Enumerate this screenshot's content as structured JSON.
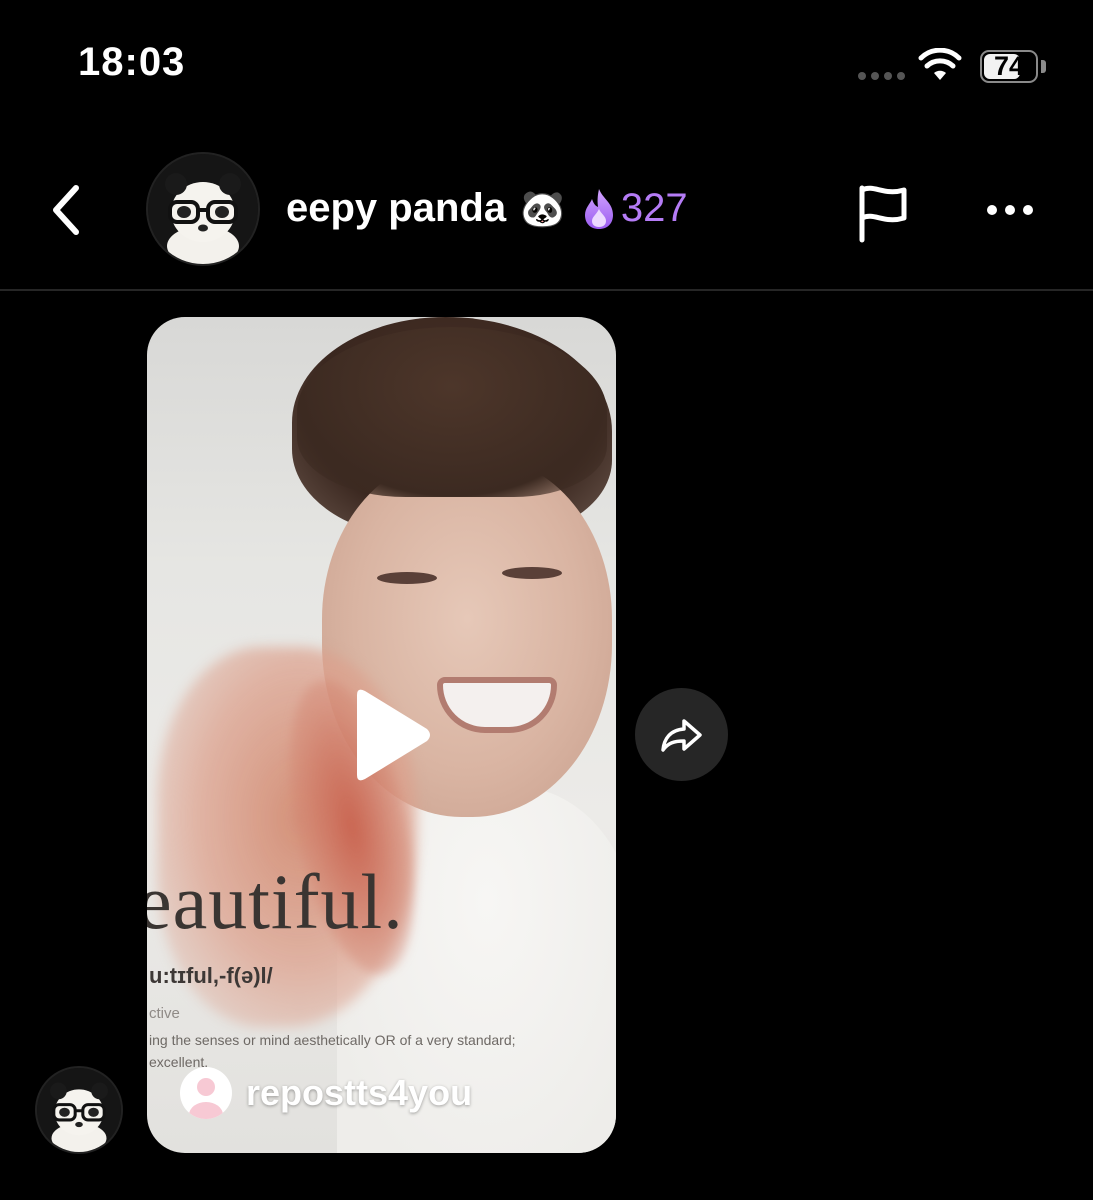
{
  "status_bar": {
    "time": "18:03",
    "battery_level": "74",
    "battery_fraction": 0.74,
    "signal_icon": "signal-dots-icon",
    "wifi_icon": "wifi-icon"
  },
  "header": {
    "back_icon": "chevron-left-icon",
    "username": "eepy panda",
    "username_emoji": "🐼",
    "streak_icon": "fire-icon",
    "streak_count": "327",
    "streak_color": "#b57cf6",
    "flag_icon": "flag-icon",
    "more_icon": "more-dots-icon"
  },
  "message": {
    "video_overlay": {
      "word": "eautiful.",
      "phonetic": "u:tɪful,-f(ə)l/",
      "part_of_speech": "ctive",
      "definition": "ing the senses or mind aesthetically OR of a very standard; excellent."
    },
    "play_icon": "play-icon",
    "repost_user": "repostts4you",
    "share_icon": "share-arrow-icon"
  },
  "colors": {
    "background": "#000000",
    "divider": "#262626",
    "share_button_bg": "#262626"
  }
}
